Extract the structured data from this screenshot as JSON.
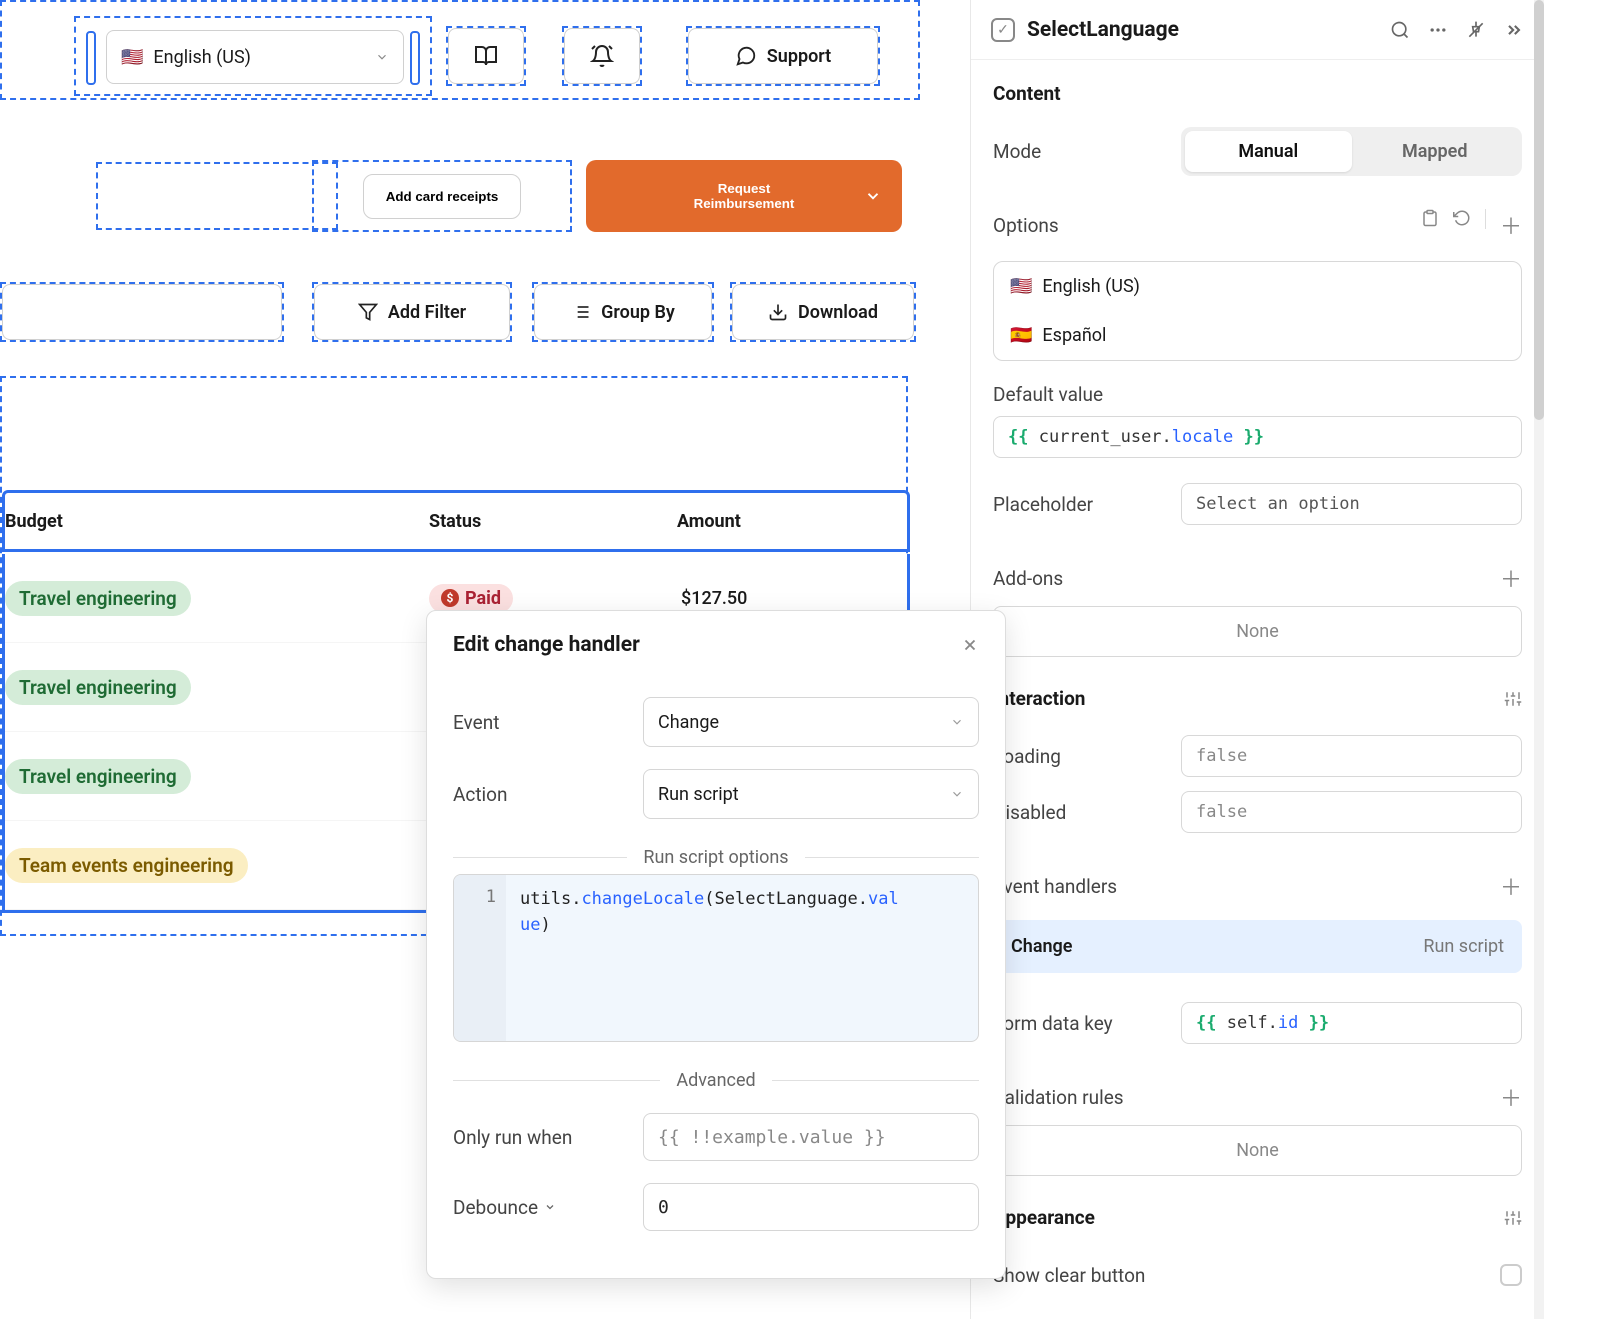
{
  "topbar": {
    "language_flag": "🇺🇸",
    "language_label": "English (US)",
    "support_label": "Support"
  },
  "actions": {
    "add_receipts": "Add card receipts",
    "request_line1": "Request",
    "request_line2": "Reimbursement"
  },
  "filters": {
    "add_filter": "Add Filter",
    "group_by": "Group By",
    "download": "Download"
  },
  "table": {
    "headers": {
      "budget": "Budget",
      "status": "Status",
      "amount": "Amount"
    },
    "rows": [
      {
        "budget": "Travel engineering",
        "budget_color": "green",
        "status": "Paid",
        "amount": "$127.50"
      },
      {
        "budget": "Travel engineering",
        "budget_color": "green",
        "status": "",
        "amount": ""
      },
      {
        "budget": "Travel engineering",
        "budget_color": "green",
        "status": "",
        "amount": ""
      },
      {
        "budget": "Team events engineering",
        "budget_color": "yellow",
        "status": "",
        "amount": ""
      }
    ]
  },
  "modal": {
    "title": "Edit change handler",
    "event_label": "Event",
    "event_value": "Change",
    "action_label": "Action",
    "action_value": "Run script",
    "run_script_options": "Run script options",
    "code_line_num": "1",
    "code_p1": "utils",
    "code_p2": ".",
    "code_p3": "changeLocale",
    "code_p4": "(SelectLanguage.",
    "code_p5": "val",
    "code_p6": "ue",
    "code_p7": ")",
    "advanced_label": "Advanced",
    "only_run_label": "Only run when",
    "only_run_placeholder": "{{ !!example.value }}",
    "debounce_label": "Debounce",
    "debounce_value": "0"
  },
  "inspector": {
    "component_name": "SelectLanguage",
    "content_title": "Content",
    "mode_label": "Mode",
    "mode_options": {
      "manual": "Manual",
      "mapped": "Mapped"
    },
    "options_label": "Options",
    "options": [
      {
        "flag": "🇺🇸",
        "label": "English (US)"
      },
      {
        "flag": "🇪🇸",
        "label": "Español"
      }
    ],
    "default_value_label": "Default value",
    "default_value_p1": " current_user",
    "default_value_p2": "locale ",
    "placeholder_label": "Placeholder",
    "placeholder_value": "Select an option",
    "addons_label": "Add-ons",
    "none_label": "None",
    "interaction_title": "Interaction",
    "loading_label": "Loading",
    "loading_value": "false",
    "disabled_label": "Disabled",
    "disabled_value": "false",
    "event_handlers_label": "Event handlers",
    "eh_item_left": "Change",
    "eh_item_right": "Run script",
    "form_data_key_label": "Form data key",
    "form_data_p1": " self",
    "form_data_p2": "id ",
    "validation_label": "Validation rules",
    "appearance_title": "Appearance",
    "show_clear_label": "Show clear button"
  }
}
